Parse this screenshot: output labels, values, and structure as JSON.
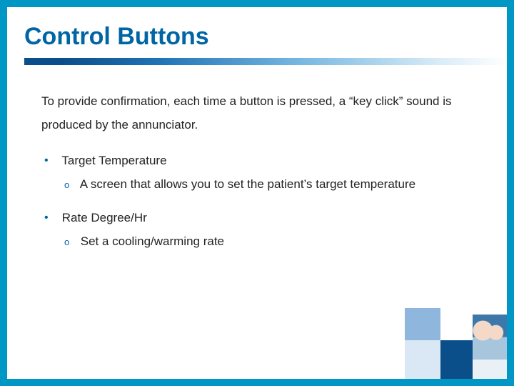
{
  "colors": {
    "border": "#0097c4",
    "heading": "#0065a4"
  },
  "title": "Control Buttons",
  "intro": "To provide confirmation, each time a button is pressed, a “key click” sound is produced by the annunciator.",
  "bullets": [
    {
      "label": "Target Temperature",
      "sub": [
        "A screen that allows you to set the patient’s target temperature"
      ]
    },
    {
      "label": "Rate Degree/Hr",
      "sub": [
        "Set a cooling/warming rate"
      ]
    }
  ]
}
